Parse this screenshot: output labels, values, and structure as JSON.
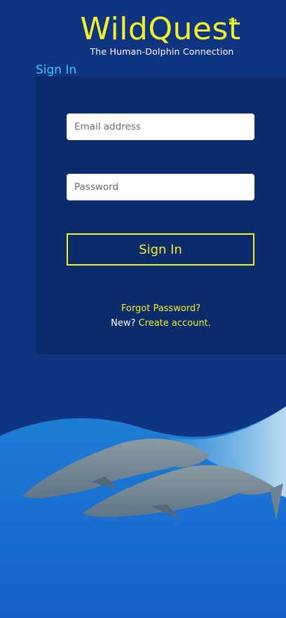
{
  "brand": {
    "name": "WildQuest",
    "trademark": "TM",
    "tagline": "The Human-Dolphin Connection"
  },
  "signin": {
    "heading": "Sign In",
    "email_placeholder": "Email address",
    "password_placeholder": "Password",
    "submit_label": "Sign In",
    "forgot_label": "Forgot Password?",
    "new_prefix": "New?",
    "create_label": "Create account."
  },
  "colors": {
    "background": "#0f3582",
    "panel": "#0a2c6b",
    "accent_yellow": "#f3ef2b",
    "heading_cyan": "#3fc3ef"
  },
  "hero_image": "dolphins-underwater"
}
